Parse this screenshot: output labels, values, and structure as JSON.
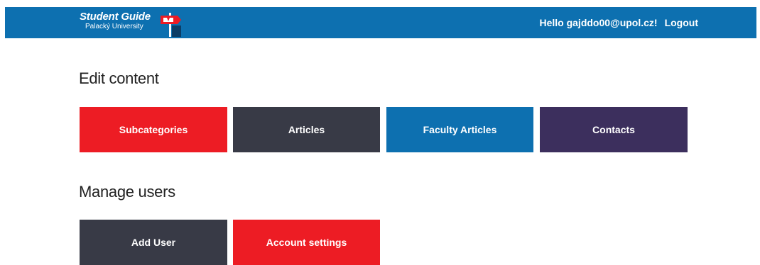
{
  "header": {
    "brand_title": "Student Guide",
    "brand_subtitle": "Palacký University",
    "logo_icon": "signpost-logo-icon",
    "greeting": "Hello gajddo00@upol.cz!",
    "logout_label": "Logout",
    "background_color": "#0d70b0"
  },
  "edit_content": {
    "title": "Edit content",
    "buttons": [
      {
        "label": "Subcategories",
        "color": "#ed1c24"
      },
      {
        "label": "Articles",
        "color": "#383a46"
      },
      {
        "label": "Faculty Articles",
        "color": "#0d70b0"
      },
      {
        "label": "Contacts",
        "color": "#3c2f5d"
      }
    ]
  },
  "manage_users": {
    "title": "Manage users",
    "buttons": [
      {
        "label": "Add User",
        "color": "#383a46"
      },
      {
        "label": "Account settings",
        "color": "#ed1c24"
      }
    ]
  }
}
